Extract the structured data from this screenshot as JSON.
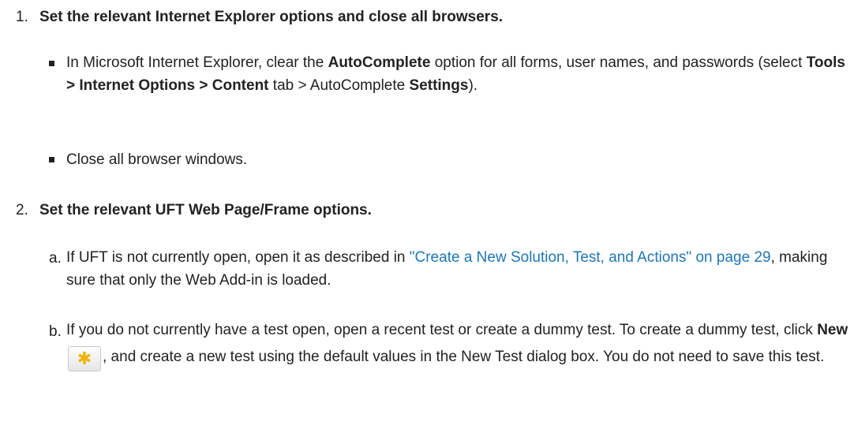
{
  "steps": [
    {
      "number": "1.",
      "title": "Set the relevant Internet Explorer options and close all browsers.",
      "bullets": [
        {
          "t1": "In Microsoft Internet Explorer, clear the ",
          "b1": "AutoComplete",
          "t2": " option for all forms, user names, and passwords (select ",
          "b2": "Tools > Internet Options > Content",
          "t3": " tab > AutoComplete ",
          "b3": "Settings",
          "t4": ")."
        },
        {
          "text": "Close all browser windows."
        }
      ]
    },
    {
      "number": "2.",
      "title": "Set the relevant UFT Web Page/Frame options.",
      "subs": [
        {
          "letter": "a.",
          "t1": "If UFT is not currently open, open it as described in ",
          "link": "\"Create a New Solution, Test, and Actions\" on page 29",
          "t2": ", making sure that only the Web Add-in is loaded."
        },
        {
          "letter": "b.",
          "t1": "If you do not currently have a test open, open a recent test or create a dummy test. To create a dummy test, click ",
          "b1": "New",
          "icon": "new-star-icon",
          "t2": ", and create a new test using the default values in the New Test dialog box. You do not need to save this test."
        }
      ]
    }
  ]
}
